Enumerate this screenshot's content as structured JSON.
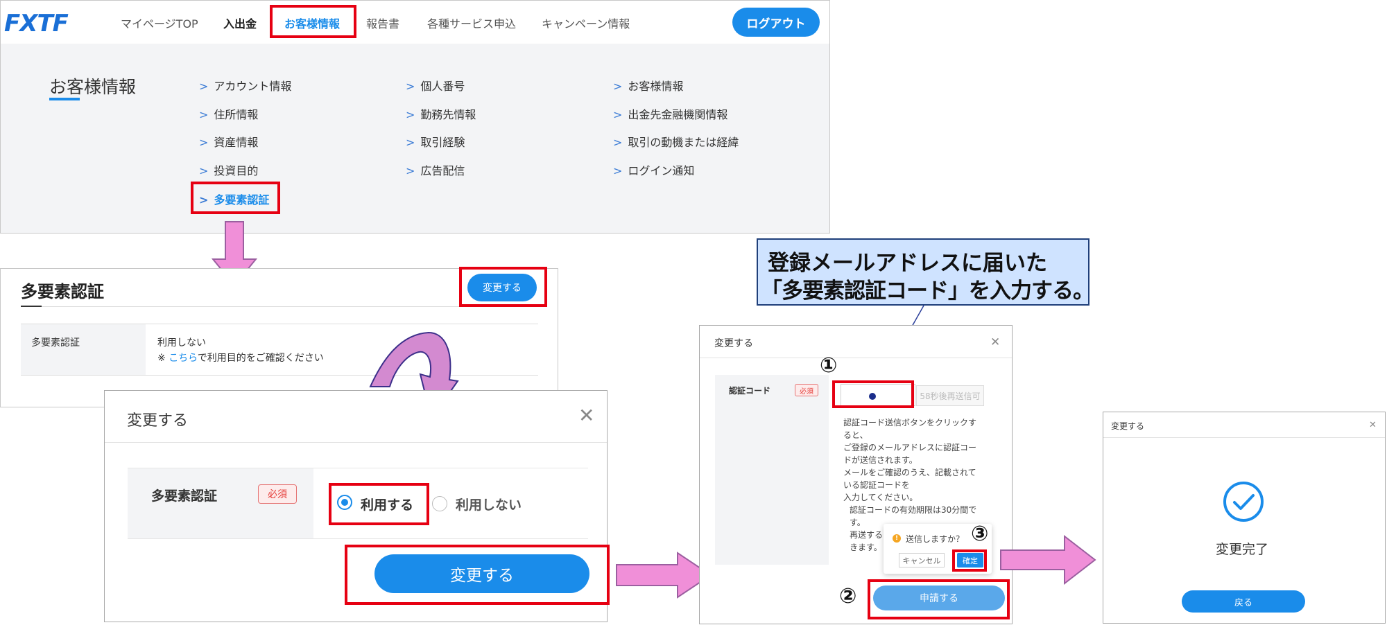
{
  "brand": {
    "logo_text": "FXTF"
  },
  "nav": {
    "items": [
      "マイページTOP",
      "入出金",
      "お客様情報",
      "報告書",
      "各種サービス申込",
      "キャンペーン情報"
    ],
    "logout": "ログアウト"
  },
  "submenu": {
    "title": "お客様情報",
    "col1": [
      "アカウント情報",
      "住所情報",
      "資産情報",
      "投資目的",
      "多要素認証"
    ],
    "col2": [
      "個人番号",
      "勤務先情報",
      "取引経験",
      "広告配信"
    ],
    "col3": [
      "お客様情報",
      "出金先金融機関情報",
      "取引の動機または経緯",
      "ログイン通知"
    ]
  },
  "mfa_page": {
    "title": "多要素認証",
    "change_button": "変更する",
    "row_label": "多要素認証",
    "row_value": "利用しない",
    "note_prefix": "※",
    "note_link": "こちら",
    "note_suffix": "で利用目的をご確認ください"
  },
  "dialog1": {
    "title": "変更する",
    "field_label": "多要素認証",
    "required": "必須",
    "option_use": "利用する",
    "option_not_use": "利用しない",
    "submit": "変更する"
  },
  "callout": {
    "line1": "登録メールアドレスに届いた",
    "line2": "「多要素認証コード」を入力する。"
  },
  "dialog2": {
    "title": "変更する",
    "field_label": "認証コード",
    "required": "必須",
    "resend": "58秒後再送信可",
    "desc_lines": [
      "認証コード送信ボタンをクリックす",
      "ると、",
      "ご登録のメールアドレスに認証コー",
      "ドが送信されます。",
      "メールをご確認のうえ、記載されて",
      "いる認証コードを",
      "入力してください。",
      "認証コードの有効期限は30分間で",
      "す。",
      "再送する",
      "きます。"
    ],
    "popconfirm_text": "送信しますか？",
    "popconfirm_cancel": "キャンセル",
    "popconfirm_ok": "確定",
    "apply": "申請する"
  },
  "dialog3": {
    "title": "変更する",
    "message": "変更完了",
    "back": "戻る"
  },
  "steps": {
    "s1": "①",
    "s2": "②",
    "s3": "③"
  },
  "colors": {
    "accent": "#1a8cea",
    "highlight": "#e60012",
    "arrow": "#f08fd8",
    "callout_bg": "#cfe3ff"
  }
}
